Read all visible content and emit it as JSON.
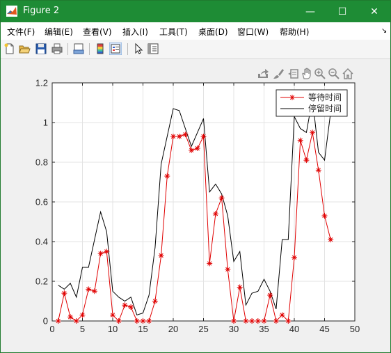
{
  "window": {
    "title": "Figure 2",
    "minimize": "—",
    "maximize": "☐",
    "close": "✕"
  },
  "menu": {
    "items": [
      "文件(F)",
      "编辑(E)",
      "查看(V)",
      "插入(I)",
      "工具(T)",
      "桌面(D)",
      "窗口(W)",
      "帮助(H)"
    ],
    "overflow": "↘"
  },
  "toolbar": {
    "icons": [
      "new-figure-icon",
      "open-file-icon",
      "save-icon",
      "print-icon",
      "link-plot-icon",
      "insert-colorbar-icon",
      "insert-legend-icon",
      "pointer-icon",
      "property-inspector-icon"
    ]
  },
  "axes_toolbar": {
    "icons": [
      "export-icon",
      "brush-icon",
      "data-tips-icon",
      "pan-icon",
      "zoom-in-icon",
      "zoom-out-icon",
      "home-icon"
    ]
  },
  "colors": {
    "titlebar": "#1e8c35",
    "series_wait": "#e00000",
    "series_stay": "#000000"
  },
  "chart_data": {
    "type": "line",
    "title": "",
    "xlabel": "",
    "ylabel": "",
    "xlim": [
      0,
      50
    ],
    "ylim": [
      0,
      1.2
    ],
    "xticks": [
      0,
      5,
      10,
      15,
      20,
      25,
      30,
      35,
      40,
      45,
      50
    ],
    "yticks": [
      0,
      0.2,
      0.4,
      0.6,
      0.8,
      1,
      1.2
    ],
    "grid": true,
    "legend": "top-right",
    "series": [
      {
        "name": "等待时间",
        "color": "#e00000",
        "marker": "*",
        "x": [
          1,
          2,
          3,
          4,
          5,
          6,
          7,
          8,
          9,
          10,
          11,
          12,
          13,
          14,
          15,
          16,
          17,
          18,
          19,
          20,
          21,
          22,
          23,
          24,
          25,
          26,
          27,
          28,
          29,
          30,
          31,
          32,
          33,
          34,
          35,
          36,
          37,
          38,
          39,
          40,
          41,
          42,
          43,
          44,
          45,
          46
        ],
        "y": [
          0,
          0.14,
          0.02,
          0,
          0.03,
          0.16,
          0.15,
          0.34,
          0.35,
          0.03,
          0,
          0.08,
          0.07,
          0,
          0,
          0,
          0.1,
          0.33,
          0.73,
          0.93,
          0.93,
          0.94,
          0.86,
          0.87,
          0.93,
          0.29,
          0.54,
          0.62,
          0.26,
          0,
          0.17,
          0,
          0,
          0,
          0,
          0.13,
          0,
          0.03,
          0,
          0.32,
          0.91,
          0.81,
          0.95,
          0.76,
          0.53,
          0.41
        ]
      },
      {
        "name": "停留时间",
        "color": "#000000",
        "marker": "",
        "x": [
          1,
          2,
          3,
          4,
          5,
          6,
          7,
          8,
          9,
          10,
          11,
          12,
          13,
          14,
          15,
          16,
          17,
          18,
          19,
          20,
          21,
          22,
          23,
          24,
          25,
          26,
          27,
          28,
          29,
          30,
          31,
          32,
          33,
          34,
          35,
          36,
          37,
          38,
          39,
          40,
          41,
          42,
          43,
          44,
          45,
          46
        ],
        "y": [
          0.18,
          0.16,
          0.19,
          0.12,
          0.27,
          0.27,
          0.41,
          0.55,
          0.45,
          0.15,
          0.12,
          0.1,
          0.12,
          0.03,
          0.04,
          0.13,
          0.37,
          0.79,
          0.93,
          1.07,
          1.06,
          0.97,
          0.88,
          0.95,
          1.02,
          0.65,
          0.69,
          0.64,
          0.53,
          0.3,
          0.35,
          0.08,
          0.14,
          0.15,
          0.21,
          0.15,
          0.06,
          0.41,
          0.41,
          1.03,
          0.97,
          0.95,
          1.12,
          0.85,
          0.81,
          1.05
        ]
      }
    ]
  }
}
